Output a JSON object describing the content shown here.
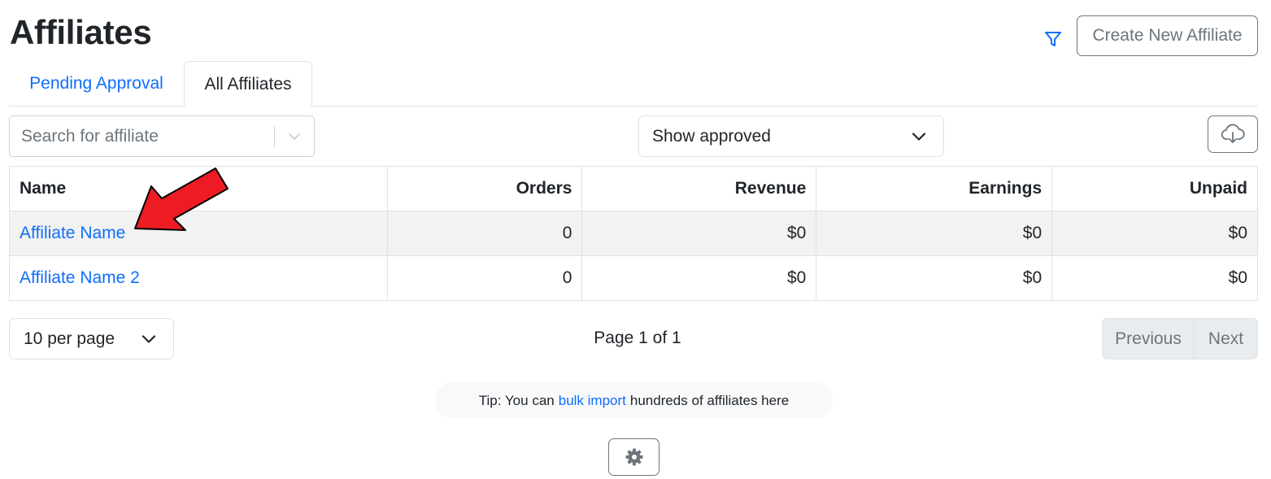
{
  "header": {
    "title": "Affiliates",
    "create_button_label": "Create New Affiliate",
    "filter_icon": "filter-icon"
  },
  "tabs": [
    {
      "label": "Pending Approval",
      "active": false
    },
    {
      "label": "All Affiliates",
      "active": true
    }
  ],
  "toolbar": {
    "search_placeholder": "Search for affiliate",
    "status_filter_value": "Show approved",
    "download_icon": "cloud-download-icon"
  },
  "table": {
    "columns": [
      "Name",
      "Orders",
      "Revenue",
      "Earnings",
      "Unpaid"
    ],
    "rows": [
      {
        "name": "Affiliate Name",
        "orders": "0",
        "revenue": "$0",
        "earnings": "$0",
        "unpaid": "$0"
      },
      {
        "name": "Affiliate Name 2",
        "orders": "0",
        "revenue": "$0",
        "earnings": "$0",
        "unpaid": "$0"
      }
    ]
  },
  "pagination": {
    "per_page_value": "10 per page",
    "page_info": "Page 1 of 1",
    "previous_label": "Previous",
    "next_label": "Next"
  },
  "tip": {
    "prefix": "Tip: You can",
    "link_text": "bulk import",
    "suffix": "hundreds of affiliates here"
  },
  "settings_icon": "gear-icon",
  "colors": {
    "link": "#0d6efd",
    "muted": "#6c757d",
    "arrow": "#ed1c24",
    "row_stripe": "#f2f2f2"
  }
}
